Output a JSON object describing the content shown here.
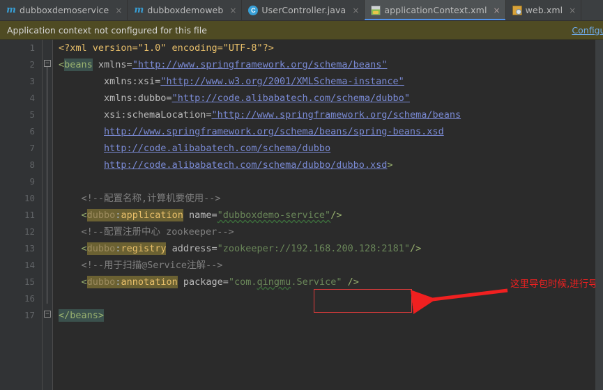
{
  "window": {
    "app": "IntelliJ IDEA Editor",
    "background": "#2b2b2b"
  },
  "tabs": [
    {
      "label": "dubboxdemoservice",
      "icon": "maven-module-icon",
      "icon_glyph": "m",
      "close": "×",
      "active": false
    },
    {
      "label": "dubboxdemoweb",
      "icon": "maven-module-icon",
      "icon_glyph": "m",
      "close": "×",
      "active": false
    },
    {
      "label": "UserController.java",
      "icon": "java-class-icon",
      "icon_glyph": "C",
      "close": "×",
      "active": false
    },
    {
      "label": "applicationContext.xml",
      "icon": "spring-config-icon",
      "icon_glyph": "",
      "close": "×",
      "active": true
    },
    {
      "label": "web.xml",
      "icon": "xml-file-icon",
      "icon_glyph": "",
      "close": "×",
      "active": false
    }
  ],
  "notification": {
    "message": "Application context not configured for this file",
    "link_label": "Configure",
    "background": "#4f4b23",
    "link_color": "#6ea9e8"
  },
  "editor": {
    "line_numbers": [
      "1",
      "2",
      "3",
      "4",
      "5",
      "6",
      "7",
      "8",
      "9",
      "10",
      "11",
      "12",
      "13",
      "14",
      "15",
      "16",
      "17"
    ],
    "fold_open_glyph": "−",
    "fold_close_glyph": "−",
    "lines": {
      "l1": "<?xml version=\"1.0\" encoding=\"UTF-8\"?>",
      "l2_tag": "beans",
      "l2_attr": "xmlns=",
      "l2_val": "\"http://www.springframework.org/schema/beans\"",
      "l3_attr": "xmlns:xsi=",
      "l3_val": "\"http://www.w3.org/2001/XMLSchema-instance\"",
      "l4_attr": "xmlns:dubbo=",
      "l4_val": "\"http://code.alibabatech.com/schema/dubbo\"",
      "l5_attr": "xsi:schemaLocation=",
      "l5_val": "\"http://www.springframework.org/schema/beans",
      "l6_val": "http://www.springframework.org/schema/beans/spring-beans.xsd",
      "l7_val": "http://code.alibabatech.com/schema/dubbo",
      "l8_val": "http://code.alibabatech.com/schema/dubbo/dubbo.xsd",
      "l10_comment": "<!--配置名称,计算机要使用-->",
      "l11_tag_ns": "dubbo",
      "l11_tag_name": "application",
      "l11_attr": "name=",
      "l11_val": "\"dubboxdemo-service\"",
      "l12_comment": "<!--配置注册中心 zookeeper-->",
      "l13_tag_ns": "dubbo",
      "l13_tag_name": "registry",
      "l13_attr": "address=",
      "l13_val": "\"zookeeper://192.168.200.128:2181\"",
      "l14_comment": "<!--用于扫描@Service注解-->",
      "l15_tag_ns": "dubbo",
      "l15_tag_name": "annotation",
      "l15_attr": "package=",
      "l15_val_prefix": "\"com.",
      "l15_val_err": "qingmu",
      "l15_val_suffix": ".Service\"",
      "l17_close": "</beans>"
    }
  },
  "annotation": {
    "text": "这里导包时候,进行导错了。",
    "color": "#f02020",
    "box_color": "#e03b3b"
  }
}
